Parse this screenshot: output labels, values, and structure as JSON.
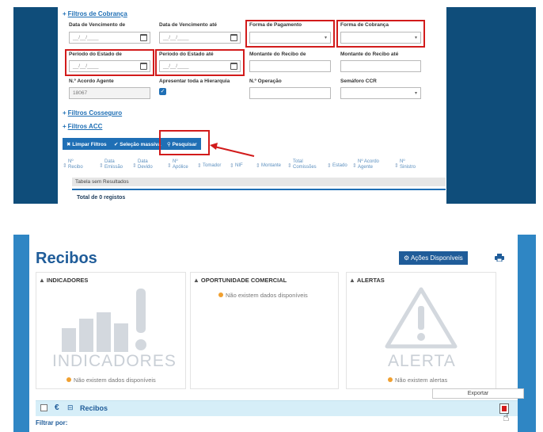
{
  "top": {
    "filtros_cobranca": "Filtros de Cobrança",
    "fields_row1": [
      {
        "label": "Data de Vencimento de",
        "value": "__/__/____"
      },
      {
        "label": "Data de Vencimento até",
        "value": "__/__/____"
      },
      {
        "label": "Forma de Pagamento",
        "value": ""
      },
      {
        "label": "Forma de Cobrança",
        "value": ""
      }
    ],
    "fields_row2": [
      {
        "label": "Período do Estado de",
        "value": "__/__/____"
      },
      {
        "label": "Período do Estado até",
        "value": "__/__/____"
      },
      {
        "label": "Montante do Recibo de",
        "value": ""
      },
      {
        "label": "Montante do Recibo até",
        "value": ""
      }
    ],
    "fields_row3": [
      {
        "label": "N.º Acordo Agente",
        "value": "18067"
      },
      {
        "label": "Apresentar toda a Hierarquia",
        "value": ""
      },
      {
        "label": "N.º Operação",
        "value": ""
      },
      {
        "label": "Semáforo CCR",
        "value": ""
      }
    ],
    "filtros_cosseguro": "Filtros Cosseguro",
    "filtros_acc": "Filtros ACC",
    "buttons": {
      "limpar": "Limpar Filtros",
      "selecao": "Seleção massiva",
      "pesquisar": "Pesquisar"
    },
    "columns": [
      {
        "l1": "Nº",
        "l2": "Recibo"
      },
      {
        "l1": "Data",
        "l2": "Emissão"
      },
      {
        "l1": "Data",
        "l2": "Devido"
      },
      {
        "l1": "Nº",
        "l2": "Apólice"
      },
      {
        "l1": "Tomador",
        "l2": ""
      },
      {
        "l1": "NIF",
        "l2": ""
      },
      {
        "l1": "Montante",
        "l2": ""
      },
      {
        "l1": "Total",
        "l2": "Comissões"
      },
      {
        "l1": "Estado",
        "l2": ""
      },
      {
        "l1": "Nº Acordo",
        "l2": "Agente"
      },
      {
        "l1": "Nº",
        "l2": "Sinistro"
      }
    ],
    "no_results": "Tabela sem Resultados",
    "total": "Total de 0 registos"
  },
  "bottom": {
    "title": "Recibos",
    "acoes": "Ações Disponíveis",
    "indicadores_head": "INDICADORES",
    "indicadores_big": "INDICADORES",
    "indicadores_nodata": "Não existem dados disponíveis",
    "oportunidade_head": "OPORTUNIDADE COMERCIAL",
    "oportunidade_nodata": "Não existem dados disponíveis",
    "alertas_head": "ALERTAS",
    "alerta_big": "ALERTA",
    "alertas_nodata": "Não existem alertas",
    "exportar": "Exportar",
    "recibos_bar_label": "Recibos",
    "currency": "€",
    "filtrar": "Filtrar por:"
  },
  "colors": {
    "accent": "#1f6fb5",
    "highlight": "#d21b1b",
    "dark_bg": "#0f4d7a",
    "header_blue": "#1f5c99"
  }
}
